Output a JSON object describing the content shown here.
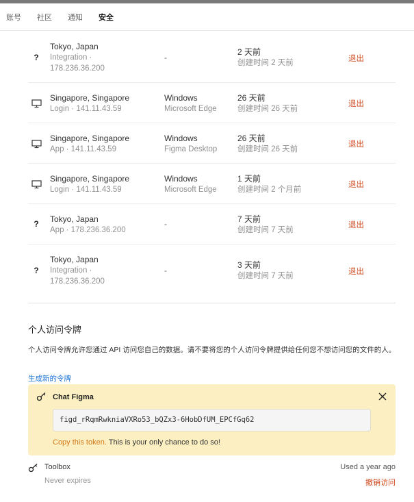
{
  "tabs": [
    {
      "label": "账号"
    },
    {
      "label": "社区"
    },
    {
      "label": "通知"
    },
    {
      "label": "安全"
    }
  ],
  "sessions": [
    {
      "icon": "question-icon",
      "location": "Tokyo, Japan",
      "detail_line1": "Integration ·",
      "detail_line2": "178.236.36.200",
      "device_os": "-",
      "device_app": "",
      "time_ago": "2 天前",
      "created": "创建时间 2 天前",
      "action": "退出"
    },
    {
      "icon": "desktop-icon",
      "location": "Singapore, Singapore",
      "detail_line1": "Login · 141.11.43.59",
      "detail_line2": "",
      "device_os": "Windows",
      "device_app": "Microsoft Edge",
      "time_ago": "26 天前",
      "created": "创建时间 26 天前",
      "action": "退出"
    },
    {
      "icon": "desktop-icon",
      "location": "Singapore, Singapore",
      "detail_line1": "App · 141.11.43.59",
      "detail_line2": "",
      "device_os": "Windows",
      "device_app": "Figma Desktop",
      "time_ago": "26 天前",
      "created": "创建时间 26 天前",
      "action": "退出"
    },
    {
      "icon": "desktop-icon",
      "location": "Singapore, Singapore",
      "detail_line1": "Login · 141.11.43.59",
      "detail_line2": "",
      "device_os": "Windows",
      "device_app": "Microsoft Edge",
      "time_ago": "1 天前",
      "created": "创建时间 2 个月前",
      "action": "退出"
    },
    {
      "icon": "question-icon",
      "location": "Tokyo, Japan",
      "detail_line1": "App · 178.236.36.200",
      "detail_line2": "",
      "device_os": "-",
      "device_app": "",
      "time_ago": "7 天前",
      "created": "创建时间 7 天前",
      "action": "退出"
    },
    {
      "icon": "question-icon",
      "location": "Tokyo, Japan",
      "detail_line1": "Integration ·",
      "detail_line2": "178.236.36.200",
      "device_os": "-",
      "device_app": "",
      "time_ago": "3 天前",
      "created": "创建时间 7 天前",
      "action": "退出"
    }
  ],
  "pat": {
    "title": "个人访问令牌",
    "description": "个人访问令牌允许您通过 API 访问您自己的数据。请不要将您的个人访问令牌提供给任何您不想访问您的文件的人。",
    "generate_link": "生成新的令牌",
    "new_token": {
      "name": "Chat Figma",
      "value": "figd_rRqmRwkniaVXRo53_bQZx3-6HobDfUM_EPCfGq62",
      "copy_label": "Copy this token.",
      "note": " This is your only chance to do so!"
    },
    "tokens": [
      {
        "name": "Toolbox",
        "expires": "Never expires",
        "last_used": "Used a year ago",
        "revoke": "撤销访问"
      }
    ]
  },
  "colors": {
    "accent_link": "#1e74d6",
    "danger": "#d04a1e",
    "token_card_bg": "#fcf0c3",
    "copy_orange": "#d1781a"
  }
}
